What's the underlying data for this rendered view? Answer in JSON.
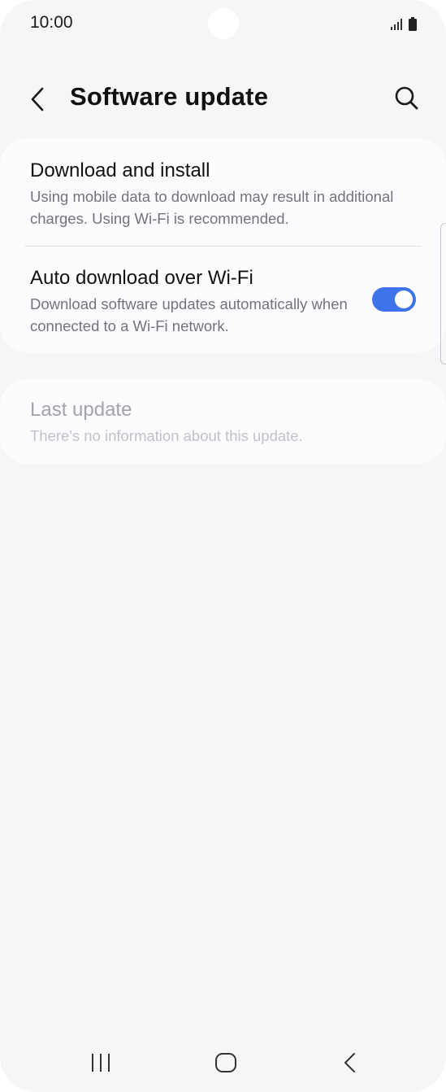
{
  "status_bar": {
    "time": "10:00"
  },
  "header": {
    "title": "Software update",
    "back_icon": "chevron-left-icon",
    "search_icon": "search-icon"
  },
  "settings": {
    "download_install": {
      "title": "Download and install",
      "description": "Using mobile data to download may result in additional charges. Using Wi-Fi is recommended."
    },
    "auto_download": {
      "title": "Auto download over Wi-Fi",
      "description": "Download software updates automatically when connected to a Wi-Fi network.",
      "enabled": true
    },
    "last_update": {
      "title": "Last update",
      "description": "There's no information about this update.",
      "disabled": true
    }
  },
  "navigation_bar": {
    "recents_icon": "recents-icon",
    "home_icon": "home-icon",
    "back_icon": "back-icon"
  },
  "colors": {
    "accent": "#3e73ea",
    "background": "#f6f6f8",
    "card": "#fcfcfe"
  }
}
